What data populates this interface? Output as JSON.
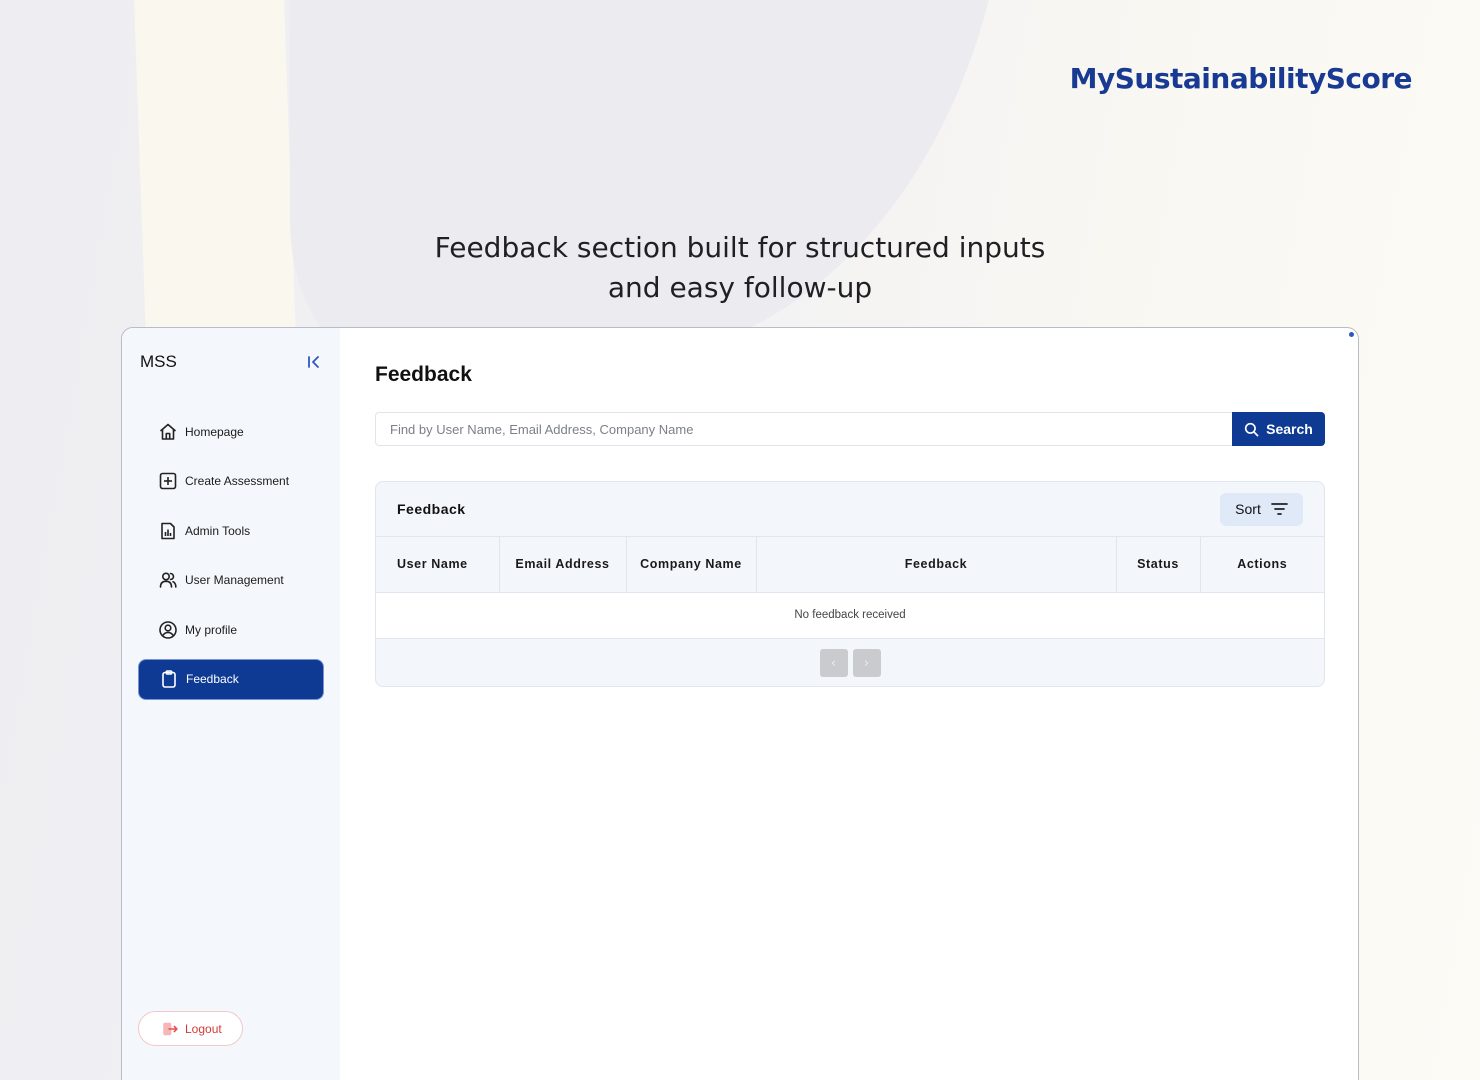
{
  "brand": {
    "name": "MySustainabilityScore"
  },
  "headline": {
    "line1": "Feedback section built for structured inputs",
    "line2": "and easy follow-up"
  },
  "sidebar": {
    "title": "MSS",
    "items": [
      {
        "label": "Homepage",
        "icon": "home-icon"
      },
      {
        "label": "Create Assessment",
        "icon": "plus-square-icon"
      },
      {
        "label": "Admin Tools",
        "icon": "chart-document-icon"
      },
      {
        "label": "User Management",
        "icon": "users-icon"
      },
      {
        "label": "My profile",
        "icon": "user-circle-icon"
      },
      {
        "label": "Feedback",
        "icon": "clipboard-icon",
        "active": true
      }
    ],
    "logout_label": "Logout"
  },
  "main": {
    "title": "Feedback",
    "search": {
      "placeholder": "Find by User Name, Email Address, Company Name",
      "button_label": "Search"
    },
    "table": {
      "title": "Feedback",
      "sort_label": "Sort",
      "columns": [
        "User Name",
        "Email Address",
        "Company Name",
        "Feedback",
        "Status",
        "Actions"
      ],
      "empty_message": "No feedback received"
    }
  },
  "colors": {
    "primary": "#0e3a94",
    "brand": "#183a93",
    "logout": "#d33b3b",
    "sidebar_bg": "#f4f8fc"
  }
}
